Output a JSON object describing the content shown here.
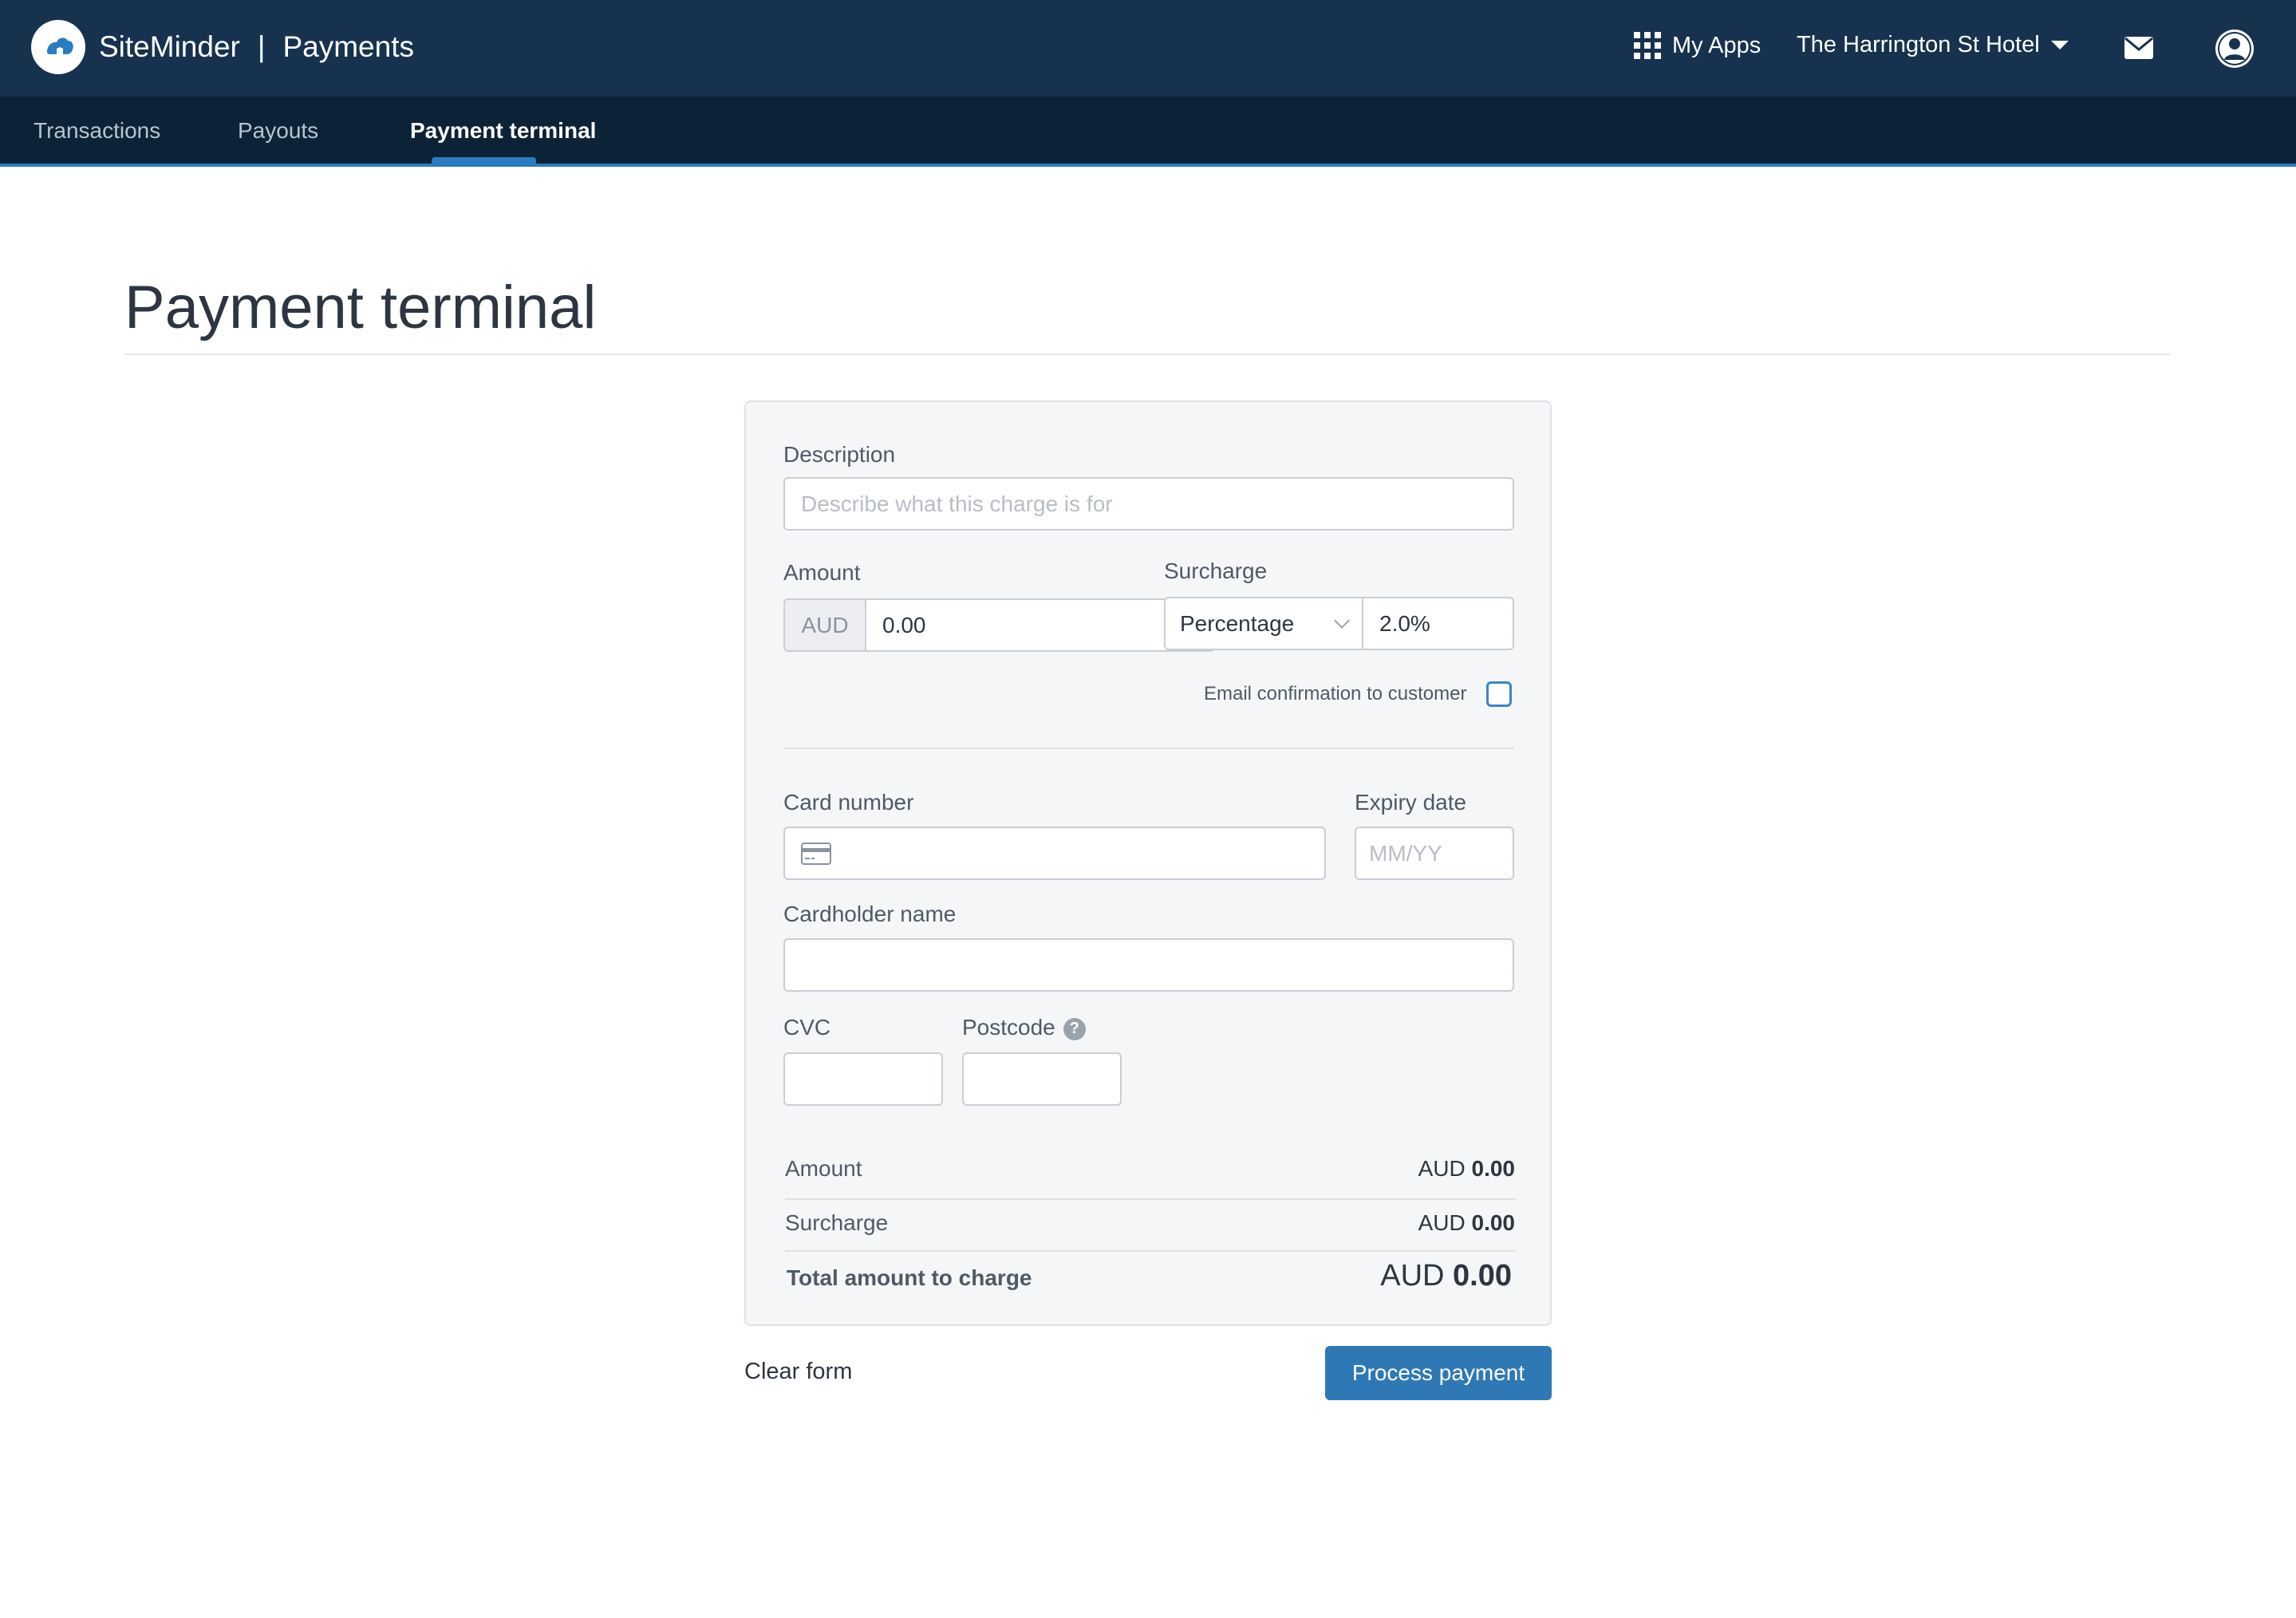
{
  "header": {
    "brand": "SiteMinder",
    "separator": "|",
    "product": "Payments",
    "my_apps_label": "My Apps",
    "hotel_name": "The Harrington St Hotel"
  },
  "subnav": {
    "items": [
      {
        "label": "Transactions"
      },
      {
        "label": "Payouts"
      },
      {
        "label": "Payment terminal"
      }
    ],
    "active": "Payment terminal"
  },
  "page": {
    "title": "Payment terminal"
  },
  "form": {
    "description_label": "Description",
    "description_placeholder": "Describe what this charge is for",
    "amount_label": "Amount",
    "currency": "AUD",
    "amount_value": "0.00",
    "surcharge_label": "Surcharge",
    "surcharge_type": "Percentage",
    "surcharge_value": "2.0%",
    "email_confirmation_label": "Email confirmation to customer",
    "email_confirmation_checked": false,
    "card_number_label": "Card number",
    "card_number_value": "",
    "expiry_label": "Expiry date",
    "expiry_placeholder": "MM/YY",
    "cardholder_label": "Cardholder name",
    "cvc_label": "CVC",
    "postcode_label": "Postcode",
    "postcode_help": "?"
  },
  "summary": {
    "amount_label": "Amount",
    "amount_currency": "AUD",
    "amount_value": "0.00",
    "surcharge_label": "Surcharge",
    "surcharge_currency": "AUD",
    "surcharge_value": "0.00",
    "total_label": "Total amount to charge",
    "total_currency": "AUD",
    "total_value": "0.00"
  },
  "actions": {
    "clear_label": "Clear form",
    "process_label": "Process payment"
  },
  "colors": {
    "header_bg": "#16324f",
    "subnav_bg": "#0c2337",
    "accent": "#2b7bc0",
    "button": "#2f78b6"
  },
  "icons": [
    "siteminder-logo-icon",
    "apps-grid-icon",
    "chevron-down-icon",
    "mail-icon",
    "user-icon",
    "credit-card-icon",
    "help-icon"
  ]
}
